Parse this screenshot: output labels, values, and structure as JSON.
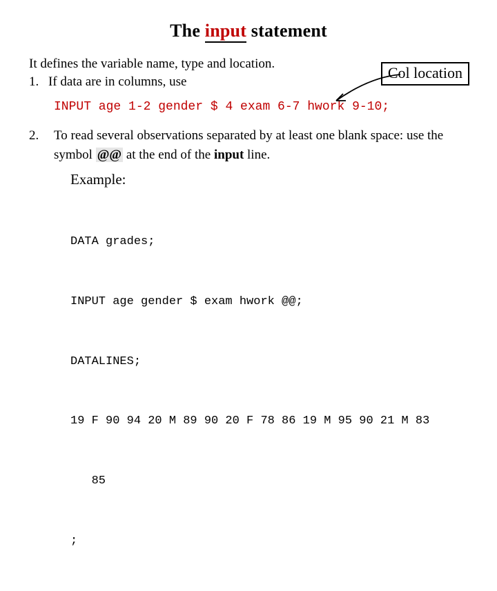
{
  "title": {
    "pre": "The ",
    "red": "input",
    "post": " statement"
  },
  "intro": "It defines the variable name, type and location.",
  "items": [
    {
      "num": "1.",
      "text": "If data are in columns, use"
    },
    {
      "num": "2.",
      "text_pre": "To read several observations separated by at least one blank space:  use the symbol ",
      "symbol": "@@",
      "text_mid": "  at the end of the ",
      "bold": "input",
      "text_post": " line."
    }
  ],
  "col_box": "Col location",
  "code1": "INPUT age 1-2 gender $ 4 exam 6-7 hwork 9-10;",
  "example_label": "Example:",
  "code_block": {
    "l1": "DATA grades;",
    "l2": "INPUT age gender $ exam hwork @@;",
    "l3": "DATALINES;",
    "l4": "19 F 90 94 20 M 89 90 20 F 78 86 19 M 95 90 21 M 83",
    "l4b": "   85",
    "l5": ";"
  }
}
